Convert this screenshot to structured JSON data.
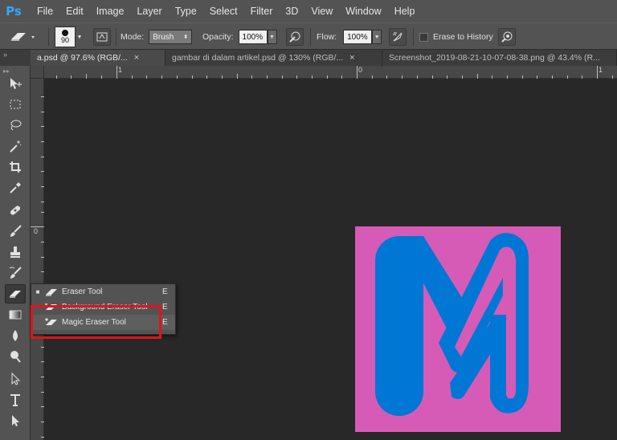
{
  "app": {
    "logo": "Ps"
  },
  "menu": [
    "File",
    "Edit",
    "Image",
    "Layer",
    "Type",
    "Select",
    "Filter",
    "3D",
    "View",
    "Window",
    "Help"
  ],
  "options": {
    "brush_size": "90",
    "mode_label": "Mode:",
    "mode_value": "Brush",
    "opacity_label": "Opacity:",
    "opacity_value": "100%",
    "flow_label": "Flow:",
    "flow_value": "100%",
    "erase_history_label": "Erase to History"
  },
  "tabs": {
    "collapse_glyph": "»",
    "items": [
      {
        "label": "a.psd @ 97.6% (RGB/...",
        "close": "×"
      },
      {
        "label": "gambar di dalam artikel.psd @ 130% (RGB/...",
        "close": "×"
      },
      {
        "label": "Screenshot_2019-08-21-10-07-08-38.png @ 43.4% (R...",
        "close": ""
      }
    ]
  },
  "rulers": {
    "h_marks": [
      "1",
      "0",
      "1"
    ],
    "v_marks": [
      "0"
    ]
  },
  "tools": [
    "move-icon",
    "marquee-icon",
    "lasso-icon",
    "magic-wand-icon",
    "crop-icon",
    "eyedropper-icon",
    "healing-brush-icon",
    "brush-icon",
    "clone-stamp-icon",
    "history-brush-icon",
    "eraser-icon",
    "gradient-icon",
    "blur-icon",
    "dodge-icon",
    "path-selection-icon",
    "type-icon",
    "direct-selection-icon"
  ],
  "flyout": {
    "items": [
      {
        "label": "Eraser Tool",
        "key": "E",
        "bullet": "■",
        "icon": "eraser-icon"
      },
      {
        "label": "Background Eraser Tool",
        "key": "E",
        "bullet": "",
        "icon": "background-eraser-icon"
      },
      {
        "label": "Magic Eraser Tool",
        "key": "E",
        "bullet": "",
        "icon": "magic-eraser-icon"
      }
    ]
  },
  "colors": {
    "highlight": "#e3131b",
    "artwork_bg": "#d65bb7",
    "artwork_fg": "#0077d4",
    "accent": "#31a8ff"
  }
}
